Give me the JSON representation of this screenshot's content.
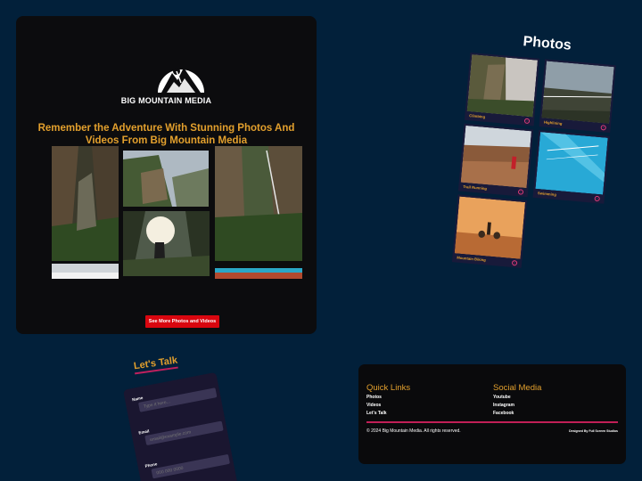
{
  "brand": {
    "name": "BIG MOUNTAIN MEDIA"
  },
  "hero": {
    "headline": "Remember the Adventure With Stunning Photos And Videos From Big Mountain Media",
    "cta_label": "See More Photos and Videos"
  },
  "photos": {
    "title": "Photos",
    "items": [
      {
        "label": "Climbing"
      },
      {
        "label": "Highlining"
      },
      {
        "label": "Trail Running"
      },
      {
        "label": "Swimming"
      },
      {
        "label": "Mountain Biking"
      }
    ]
  },
  "contact": {
    "title": "Let's Talk",
    "fields": [
      {
        "label": "Name",
        "placeholder": "Type it here..."
      },
      {
        "label": "Email",
        "placeholder": "email@example.com"
      },
      {
        "label": "Phone",
        "placeholder": "000 000 0000"
      }
    ]
  },
  "footer": {
    "quick_links_title": "Quick Links",
    "quick_links": [
      "Photos",
      "Videos",
      "Let's Talk"
    ],
    "social_title": "Social Media",
    "social_links": [
      "Youtube",
      "Instagram",
      "Facebook"
    ],
    "copyright": "© 2024 Big Mountain Media. All rights reserved.",
    "credit": "Designed By Full Screen Studios"
  },
  "colors": {
    "page_bg": "#02203a",
    "card_bg": "#0c0c0e",
    "accent": "#e3a02d",
    "cta": "#d9060f",
    "divider": "#c11f57"
  }
}
